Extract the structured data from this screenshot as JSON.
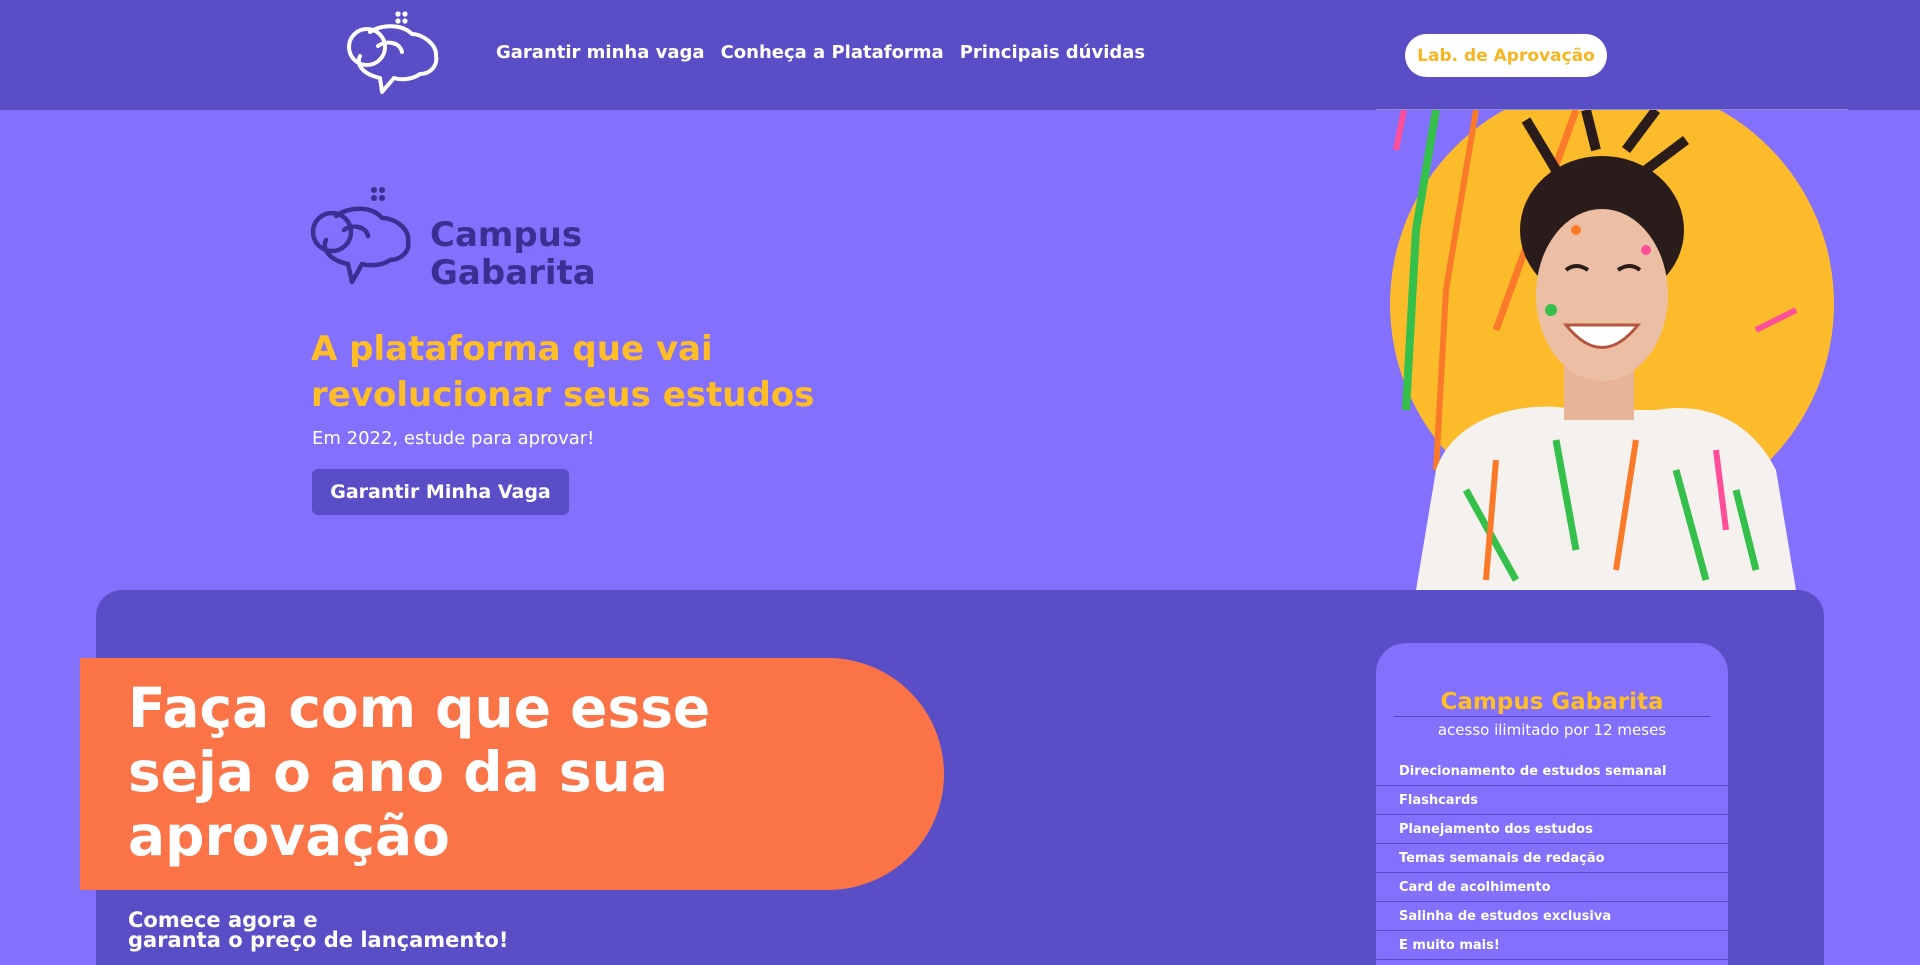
{
  "nav": {
    "links": [
      "Garantir minha vaga",
      "Conheça a Plataforma",
      "Principais dúvidas"
    ],
    "cta": "Lab. de Aprovação"
  },
  "hero": {
    "brand_line1": "Campus",
    "brand_line2": "Gabarita",
    "headline": "A plataforma que vai revolucionar seus estudos",
    "subtitle": "Em 2022, estude para aprovar!",
    "cta": "Garantir Minha Vaga"
  },
  "promo": {
    "title": "Faça com que esse seja o ano da sua aprovação",
    "start_line1": "Comece agora e",
    "start_line2": "garanta o preço de lançamento!"
  },
  "card": {
    "title": "Campus Gabarita",
    "subtitle": "acesso ilimitado por 12 meses",
    "features": [
      "Direcionamento de estudos semanal",
      "Flashcards",
      "Planejamento dos estudos",
      "Temas semanais de redação",
      "Card de acolhimento",
      "Salinha de estudos exclusiva",
      "E muito mais!"
    ]
  },
  "colors": {
    "nav_bg": "#5a4ec7",
    "page_bg": "#8370fc",
    "accent_yellow": "#ffbd26",
    "accent_orange": "#fa7447",
    "logo_dark": "#3b2f94"
  },
  "icons": {
    "nav_logo": "brain-speech-bubble-logo",
    "hero_logo": "brain-speech-bubble-logo",
    "hero_photo": "paint-splattered-smiling-woman"
  }
}
